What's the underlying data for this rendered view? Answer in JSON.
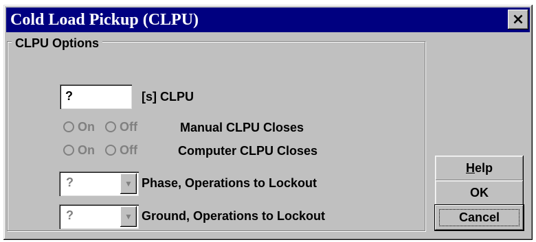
{
  "window": {
    "title": "Cold Load Pickup (CLPU)",
    "close_glyph": "×"
  },
  "group": {
    "legend": "CLPU Options"
  },
  "clpu_time": {
    "value": "?",
    "label": "[s] CLPU"
  },
  "manual_closes": {
    "on_label": "On",
    "off_label": "Off",
    "label": "Manual CLPU Closes"
  },
  "computer_closes": {
    "on_label": "On",
    "off_label": "Off",
    "label": "Computer CLPU Closes"
  },
  "phase_ops": {
    "value": "?",
    "label": "Phase, Operations to Lockout"
  },
  "ground_ops": {
    "value": "?",
    "label": "Ground, Operations to Lockout"
  },
  "buttons": {
    "help_mnemonic": "H",
    "help_rest": "elp",
    "ok": "OK",
    "cancel": "Cancel"
  },
  "colors": {
    "titlebar": "#000080",
    "face": "#c0c0c0",
    "disabled_text": "#808080"
  }
}
